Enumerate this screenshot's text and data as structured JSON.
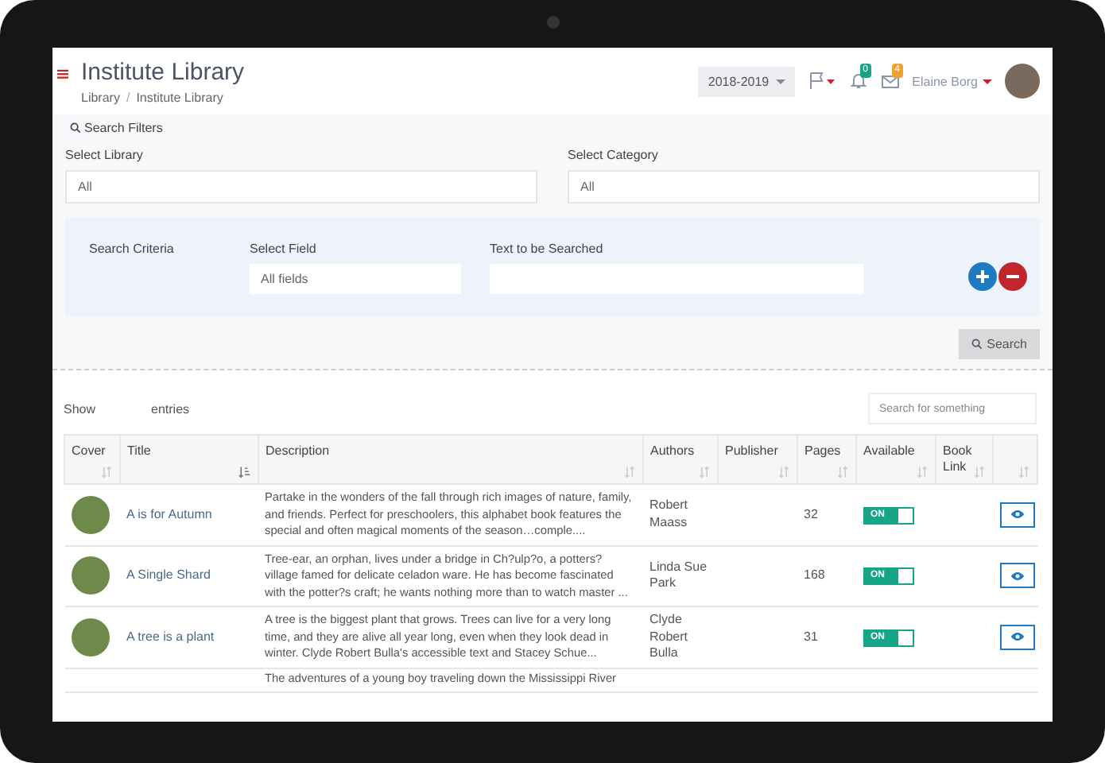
{
  "header": {
    "title": "Institute Library",
    "breadcrumb": [
      "Library",
      "Institute Library"
    ],
    "breadcrumb_separator": "/",
    "year": "2018-2019",
    "notifications": "0",
    "messages": "4",
    "user": "Elaine Borg"
  },
  "filters": {
    "heading": "Search Filters",
    "library": {
      "label": "Select Library",
      "value": "All"
    },
    "category": {
      "label": "Select Category",
      "value": "All"
    },
    "criteria": {
      "label": "Search Criteria",
      "field_label": "Select Field",
      "field_value": "All fields",
      "text_label": "Text to be Searched"
    },
    "search_button": "Search"
  },
  "table": {
    "show_label": "Show",
    "entries_label": "entries",
    "search_placeholder": "Search for something",
    "columns": [
      {
        "label": "Cover",
        "sorted": false
      },
      {
        "label": "Title",
        "sorted": true
      },
      {
        "label": "Description",
        "sorted": false
      },
      {
        "label": "Authors",
        "sorted": false
      },
      {
        "label": "Publisher",
        "sorted": false
      },
      {
        "label": "Pages",
        "sorted": false
      },
      {
        "label": "Available",
        "sorted": false
      },
      {
        "label": "Book Link",
        "sorted": false
      },
      {
        "sorted": false
      }
    ],
    "rows": [
      {
        "title": "A is for Autumn",
        "description": "Partake in the wonders of the fall through rich images of nature, family, and friends. Perfect for preschoolers, this alphabet book features the special and often magical moments of the season…comple....",
        "authors": "Robert Maass",
        "pages": "32",
        "available": true,
        "toggle_label": "ON"
      },
      {
        "title": "A Single Shard",
        "description": "Tree-ear, an orphan, lives under a bridge in Ch?ulp?o, a potters? village famed for delicate celadon ware. He has become fascinated with the potter?s craft; he wants nothing more than to watch master ...",
        "authors": "Linda Sue Park",
        "pages": "168",
        "available": true,
        "toggle_label": "ON"
      },
      {
        "title": "A tree is a plant",
        "description": "A tree is the biggest plant that grows. Trees can live for a very long time, and they are alive all year long, even when they look dead in winter. Clyde Robert Bulla's accessible text and Stacey Schue...",
        "authors": "Clyde Robert Bulla",
        "pages": "31",
        "available": true,
        "toggle_label": "ON"
      },
      {
        "description": "The adventures of a young boy traveling down the Mississippi River"
      }
    ]
  }
}
